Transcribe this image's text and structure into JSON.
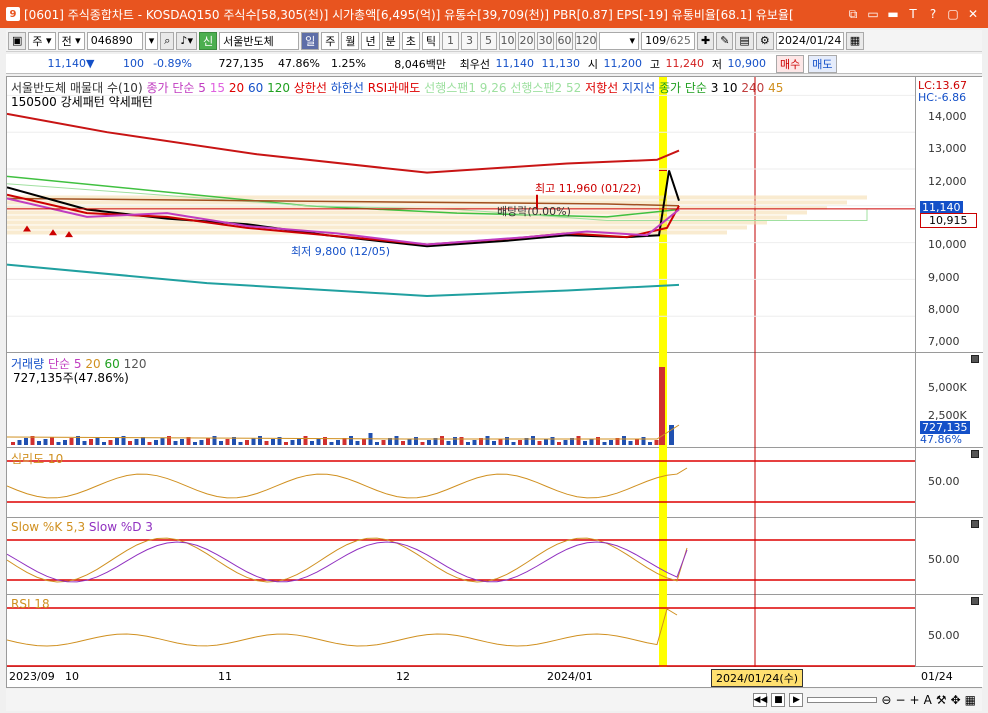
{
  "titlebar": {
    "text": "[0601] 주식종합차트 - KOSDAQ150 주식수[58,305(천)] 시가총액[6,495(억)] 유통수[39,709(천)] PBR[0.87] EPS[-19] 유통비율[68.1] 유보율[",
    "logo": "9",
    "buttons": [
      "⧉",
      "▭",
      "▬",
      "T",
      "?",
      "▢",
      "✕"
    ]
  },
  "toolbar1": {
    "type1": "주",
    "type2": "전",
    "code": "046890",
    "name_badge": "신",
    "stock_name": "서울반도체",
    "periods": [
      "일",
      "주",
      "월",
      "년",
      "분",
      "초",
      "틱"
    ],
    "selected_period": "일",
    "numbers": [
      "1",
      "3",
      "5",
      "10",
      "20",
      "30",
      "60",
      "120"
    ],
    "count": "109",
    "total": "/625",
    "date": "2024/01/24"
  },
  "toolbar2": {
    "price": "11,140",
    "arrow": "▼",
    "change": "100",
    "rate": "-0.89%",
    "volume": "727,135",
    "vol_ratio": "47.86%",
    "turnover": "1.25%",
    "amount": "8,046백만",
    "best_label": "최우선",
    "best_sell": "11,140",
    "best_buy": "11,130",
    "open_label": "시",
    "open": "11,200",
    "high_label": "고",
    "high": "11,240",
    "low_label": "저",
    "low": "10,900",
    "buy_btn": "매수",
    "sell_btn": "매도"
  },
  "price_pane": {
    "legend_name": "서울반도체 매물대 수(10)",
    "legend_ma": "종가 단순",
    "ma1": "5",
    "ma2": "15",
    "ma3": "20",
    "ma4": "60",
    "ma5": "120",
    "upper": "상한선",
    "lower": "하한선",
    "rsi_over": "RSI과매도",
    "span1": "선행스팬1",
    "span_val": "9,26",
    "span2": "선행스팬2",
    "span2_val": "52",
    "resist": "저항선",
    "support": "지지선",
    "legend_ma2": "종가 단순",
    "mb1": "3",
    "mb2": "10",
    "mb3": "240",
    "mb4": "45",
    "lc": "LC:13.67",
    "hc": "HC:-6.86",
    "pattern1": "150500 강세패턴",
    "pattern2": "약세패턴",
    "high_note": "최고 11,960 (01/22)",
    "low_note": "최저 9,800 (12/05)",
    "dividend_note": "배당락(0.00%)",
    "yticks": [
      "14,000",
      "13,000",
      "12,000",
      "11,140",
      "10,000",
      "9,000",
      "8,000",
      "7,000"
    ],
    "current_tag": "10,915"
  },
  "volume_pane": {
    "legend": "거래량",
    "ma_label": "단순",
    "m1": "5",
    "m2": "20",
    "m3": "60",
    "m4": "120",
    "value": "727,135주(47.86%)",
    "yticks": [
      "5,000K",
      "2,500K"
    ],
    "cur": "727,135",
    "cur_pct": "47.86%"
  },
  "psych_pane": {
    "legend": "심리도 10",
    "ytick": "50.00"
  },
  "stoch_pane": {
    "legend": "Slow %K 5,3",
    "legend2": "Slow %D 3",
    "ytick": "50.00"
  },
  "rsi_pane": {
    "legend": "RSI 18",
    "ytick": "50.00"
  },
  "xaxis": {
    "labels": [
      "2023/09",
      "10",
      "11",
      "12",
      "2024/01"
    ],
    "cursor_date": "2024/01/24(수)",
    "right": "01/24"
  },
  "chart_data": {
    "type": "line",
    "price": {
      "x": [
        "2023/09",
        "2023/10",
        "2023/11",
        "2023/12",
        "2024/01/22",
        "2024/01/24"
      ],
      "close": [
        10900,
        10400,
        10300,
        9900,
        11960,
        11140
      ]
    },
    "high_max": 11960,
    "low_min": 9800,
    "ylim": [
      7000,
      14500
    ],
    "colors": {
      "ma120": "#c81414",
      "upper": "#e08060",
      "lower": "#20a0a0",
      "ma60": "#40c040",
      "cursor": "#ffff00",
      "vline": "#c00000",
      "cloud": "#f5ddb0"
    }
  }
}
